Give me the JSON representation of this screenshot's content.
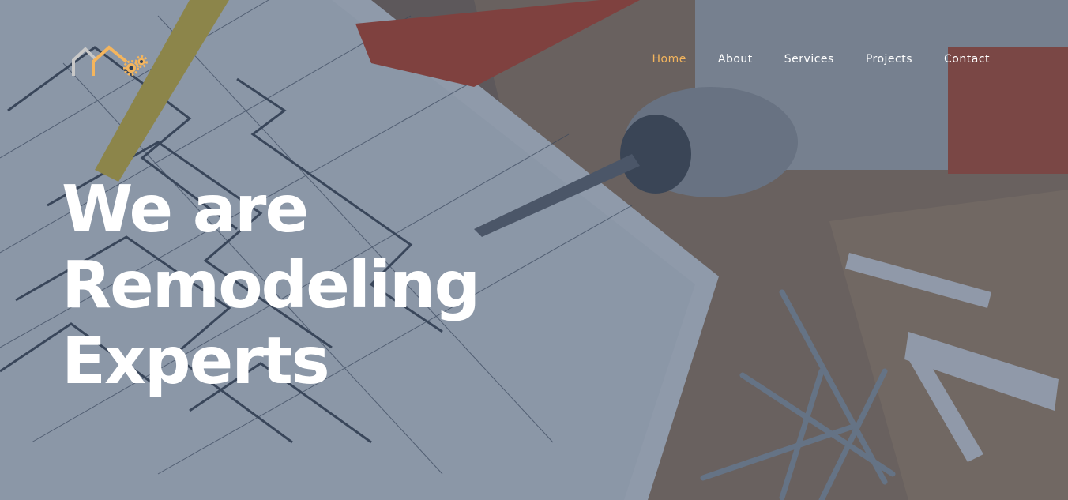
{
  "logo": {
    "icon": "house-gears-logo-icon",
    "colors": {
      "house_outline": "#c8c8c8",
      "house_roof": "#f4b55d",
      "gears": "#f4b55d"
    }
  },
  "nav": {
    "items": [
      {
        "label": "Home",
        "active": true
      },
      {
        "label": "About",
        "active": false
      },
      {
        "label": "Services",
        "active": false
      },
      {
        "label": "Projects",
        "active": false
      },
      {
        "label": "Contact",
        "active": false
      }
    ],
    "active_color": "#f4b55d",
    "text_color": "#ffffff"
  },
  "hero": {
    "headline_lines": [
      "We are",
      "Remodeling",
      "Experts"
    ],
    "background": "blueprint-drill-screws-photo",
    "overlay_color": "#263854"
  }
}
